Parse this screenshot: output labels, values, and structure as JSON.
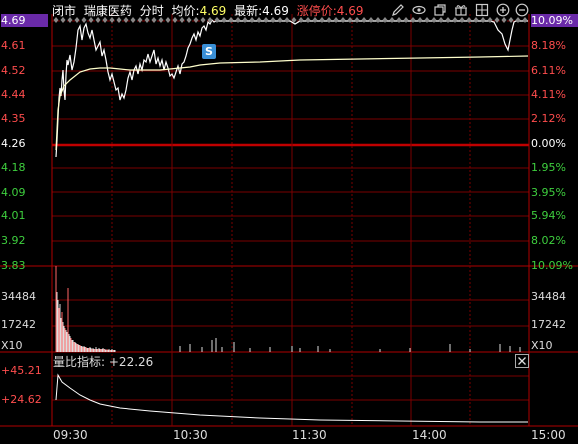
{
  "header": {
    "status": "闭市",
    "stock_name": "瑞康医药",
    "mode": "分时",
    "avg_label": "均价:",
    "avg_value": "4.69",
    "latest_label": "最新:",
    "latest_value": "4.69",
    "limit_label": "涨停价:",
    "limit_value": "4.69"
  },
  "icons": [
    "pencil-icon",
    "eye-icon",
    "copy-icon",
    "gift-icon",
    "grid-icon",
    "zoom-in-icon",
    "zoom-out-icon"
  ],
  "price_axis": {
    "left": [
      "4.69",
      "4.61",
      "4.52",
      "4.44",
      "4.35",
      "4.26",
      "4.18",
      "4.09",
      "4.01",
      "3.92",
      "3.83"
    ],
    "right": [
      "10.09%",
      "8.18%",
      "6.11%",
      "4.11%",
      "2.12%",
      "0.00%",
      "1.95%",
      "3.95%",
      "5.94%",
      "8.02%",
      "10.09%"
    ],
    "prev_close": "4.26"
  },
  "volume_axis": {
    "left": [
      "34484",
      "17242"
    ],
    "right": [
      "34484",
      "17242"
    ],
    "unit_left": "X10",
    "unit_right": "X10"
  },
  "indicator": {
    "label": "量比指标:",
    "value": "+22.26",
    "axis": [
      "+45.21",
      "+24.62"
    ]
  },
  "time_axis": [
    "09:30",
    "10:30",
    "11:30",
    "14:00",
    "15:00"
  ],
  "marker": {
    "label": "S"
  },
  "colors": {
    "up": "#ff4d4d",
    "down": "#3ecf3e",
    "grid": "#7a0000",
    "price_line": "#ffffff",
    "avg_line": "#ffff99",
    "highlight": "#6a2aa8",
    "marker": "#3a8fd6"
  }
}
